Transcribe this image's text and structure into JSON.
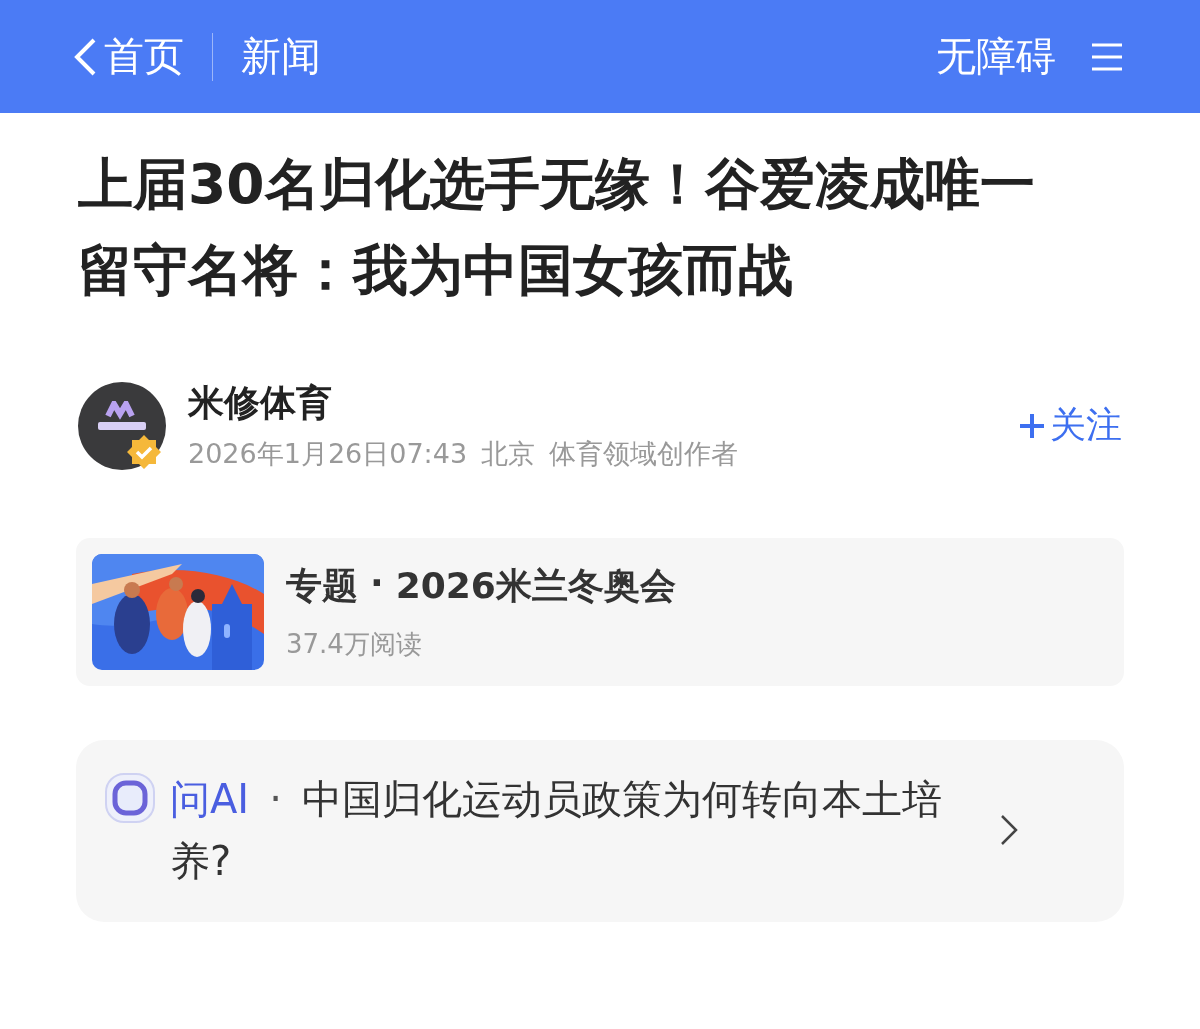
{
  "nav": {
    "back": "首页",
    "section": "新闻",
    "accessibility": "无障碍"
  },
  "article": {
    "title": "上届30名归化选手无缘！谷爱凌成唯一留守名将：我为中国女孩而战"
  },
  "author": {
    "name": "米修体育",
    "verified": true,
    "time": "2026年1月26日07:43",
    "location": "北京",
    "role": "体育领域创作者",
    "follow": "关注"
  },
  "topic": {
    "label": "专题",
    "separator": "·",
    "name": "2026米兰冬奥会",
    "reads": "37.4万阅读"
  },
  "ask_ai": {
    "label": "问AI",
    "separator": "·",
    "question": "中国归化运动员政策为何转向本土培养?"
  }
}
